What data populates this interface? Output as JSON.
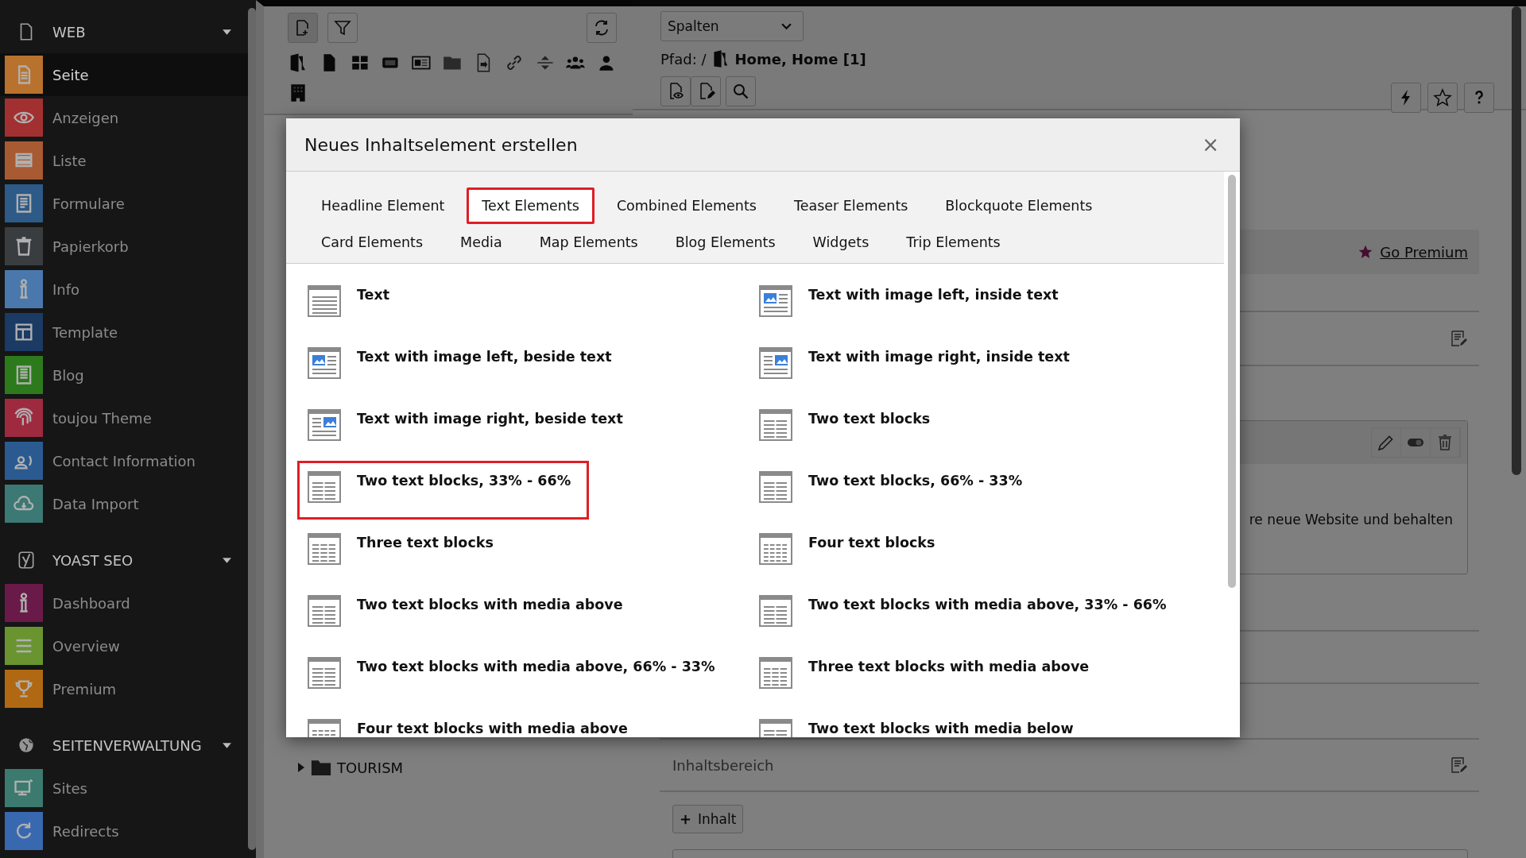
{
  "sidebar": {
    "groups": [
      {
        "label": "WEB",
        "expanded": true,
        "items": [
          {
            "label": "Seite",
            "color": "#b8722e",
            "selected": true
          },
          {
            "label": "Anzeigen",
            "color": "#a33030",
            "selected": false
          },
          {
            "label": "Liste",
            "color": "#a85a32",
            "selected": false
          },
          {
            "label": "Formulare",
            "color": "#2d5a86",
            "selected": false
          },
          {
            "label": "Papierkorb",
            "color": "#3a3d40",
            "selected": false
          },
          {
            "label": "Info",
            "color": "#4a78ac",
            "selected": false
          },
          {
            "label": "Template",
            "color": "#1b3a64",
            "selected": false
          },
          {
            "label": "Blog",
            "color": "#2c7a1c",
            "selected": false
          },
          {
            "label": "toujou Theme",
            "color": "#9e2a40",
            "selected": false
          },
          {
            "label": "Contact Information",
            "color": "#2a5a90",
            "selected": false
          },
          {
            "label": "Data Import",
            "color": "#3c7874",
            "selected": false
          }
        ]
      },
      {
        "label": "YOAST SEO",
        "expanded": true,
        "items": [
          {
            "label": "Dashboard",
            "color": "#6a1a48",
            "selected": false
          },
          {
            "label": "Overview",
            "color": "#6a9430",
            "selected": false
          },
          {
            "label": "Premium",
            "color": "#b06812",
            "selected": false
          }
        ]
      },
      {
        "label": "SEITENVERWALTUNG",
        "expanded": true,
        "items": [
          {
            "label": "Sites",
            "color": "#3c7a70",
            "selected": false
          },
          {
            "label": "Redirects",
            "color": "#3868b0",
            "selected": false
          }
        ]
      }
    ]
  },
  "tree_panel": {
    "tree": [
      {
        "label": "TOURISM",
        "expanded": false
      }
    ]
  },
  "docheader": {
    "view_select": "Spalten",
    "path_label": "Pfad: /",
    "path_page": "Home, Home [1]"
  },
  "content": {
    "premium_link": "Go Premium",
    "card_text": "re neue Website und behalten",
    "section_title": "Inhaltsbereich",
    "add_button": "Inhalt"
  },
  "modal": {
    "title": "Neues Inhaltselement erstellen",
    "close": "×",
    "tab_rows": [
      [
        {
          "label": "Headline Element",
          "selected": false
        },
        {
          "label": "Text Elements",
          "selected": true
        },
        {
          "label": "Combined Elements",
          "selected": false
        },
        {
          "label": "Teaser Elements",
          "selected": false
        },
        {
          "label": "Blockquote Elements",
          "selected": false
        }
      ],
      [
        {
          "label": "Card Elements",
          "selected": false
        },
        {
          "label": "Media",
          "selected": false
        },
        {
          "label": "Map Elements",
          "selected": false
        },
        {
          "label": "Blog Elements",
          "selected": false
        },
        {
          "label": "Widgets",
          "selected": false
        },
        {
          "label": "Trip Elements",
          "selected": false
        }
      ]
    ],
    "items": [
      {
        "label": "Text",
        "highlighted": false
      },
      {
        "label": "Text with image left, inside text",
        "highlighted": false
      },
      {
        "label": "Text with image left, beside text",
        "highlighted": false
      },
      {
        "label": "Text with image right, inside text",
        "highlighted": false
      },
      {
        "label": "Text with image right, beside text",
        "highlighted": false
      },
      {
        "label": "Two text blocks",
        "highlighted": false
      },
      {
        "label": "Two text blocks, 33% - 66%",
        "highlighted": true
      },
      {
        "label": "Two text blocks, 66% - 33%",
        "highlighted": false
      },
      {
        "label": "Three text blocks",
        "highlighted": false
      },
      {
        "label": "Four text blocks",
        "highlighted": false
      },
      {
        "label": "Two text blocks with media above",
        "highlighted": false
      },
      {
        "label": "Two text blocks with media above, 33% - 66%",
        "highlighted": false
      },
      {
        "label": "Two text blocks with media above, 66% - 33%",
        "highlighted": false
      },
      {
        "label": "Three text blocks with media above",
        "highlighted": false
      },
      {
        "label": "Four text blocks with media above",
        "highlighted": false
      },
      {
        "label": "Two text blocks with media below",
        "highlighted": false
      }
    ]
  }
}
